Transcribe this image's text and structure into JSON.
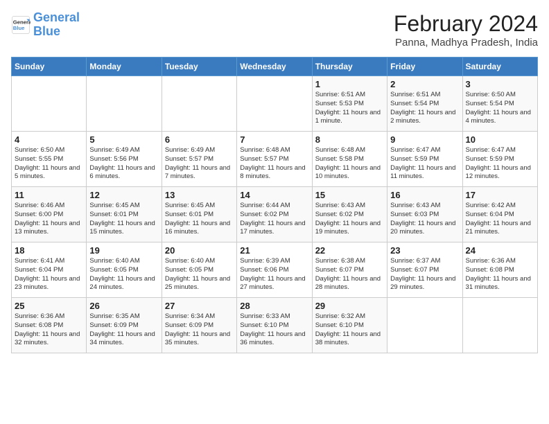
{
  "header": {
    "logo_line1": "General",
    "logo_line2": "Blue",
    "title": "February 2024",
    "subtitle": "Panna, Madhya Pradesh, India"
  },
  "columns": [
    "Sunday",
    "Monday",
    "Tuesday",
    "Wednesday",
    "Thursday",
    "Friday",
    "Saturday"
  ],
  "weeks": [
    [
      {
        "day": "",
        "info": ""
      },
      {
        "day": "",
        "info": ""
      },
      {
        "day": "",
        "info": ""
      },
      {
        "day": "",
        "info": ""
      },
      {
        "day": "1",
        "info": "Sunrise: 6:51 AM\nSunset: 5:53 PM\nDaylight: 11 hours and 1 minute."
      },
      {
        "day": "2",
        "info": "Sunrise: 6:51 AM\nSunset: 5:54 PM\nDaylight: 11 hours and 2 minutes."
      },
      {
        "day": "3",
        "info": "Sunrise: 6:50 AM\nSunset: 5:54 PM\nDaylight: 11 hours and 4 minutes."
      }
    ],
    [
      {
        "day": "4",
        "info": "Sunrise: 6:50 AM\nSunset: 5:55 PM\nDaylight: 11 hours and 5 minutes."
      },
      {
        "day": "5",
        "info": "Sunrise: 6:49 AM\nSunset: 5:56 PM\nDaylight: 11 hours and 6 minutes."
      },
      {
        "day": "6",
        "info": "Sunrise: 6:49 AM\nSunset: 5:57 PM\nDaylight: 11 hours and 7 minutes."
      },
      {
        "day": "7",
        "info": "Sunrise: 6:48 AM\nSunset: 5:57 PM\nDaylight: 11 hours and 8 minutes."
      },
      {
        "day": "8",
        "info": "Sunrise: 6:48 AM\nSunset: 5:58 PM\nDaylight: 11 hours and 10 minutes."
      },
      {
        "day": "9",
        "info": "Sunrise: 6:47 AM\nSunset: 5:59 PM\nDaylight: 11 hours and 11 minutes."
      },
      {
        "day": "10",
        "info": "Sunrise: 6:47 AM\nSunset: 5:59 PM\nDaylight: 11 hours and 12 minutes."
      }
    ],
    [
      {
        "day": "11",
        "info": "Sunrise: 6:46 AM\nSunset: 6:00 PM\nDaylight: 11 hours and 13 minutes."
      },
      {
        "day": "12",
        "info": "Sunrise: 6:45 AM\nSunset: 6:01 PM\nDaylight: 11 hours and 15 minutes."
      },
      {
        "day": "13",
        "info": "Sunrise: 6:45 AM\nSunset: 6:01 PM\nDaylight: 11 hours and 16 minutes."
      },
      {
        "day": "14",
        "info": "Sunrise: 6:44 AM\nSunset: 6:02 PM\nDaylight: 11 hours and 17 minutes."
      },
      {
        "day": "15",
        "info": "Sunrise: 6:43 AM\nSunset: 6:02 PM\nDaylight: 11 hours and 19 minutes."
      },
      {
        "day": "16",
        "info": "Sunrise: 6:43 AM\nSunset: 6:03 PM\nDaylight: 11 hours and 20 minutes."
      },
      {
        "day": "17",
        "info": "Sunrise: 6:42 AM\nSunset: 6:04 PM\nDaylight: 11 hours and 21 minutes."
      }
    ],
    [
      {
        "day": "18",
        "info": "Sunrise: 6:41 AM\nSunset: 6:04 PM\nDaylight: 11 hours and 23 minutes."
      },
      {
        "day": "19",
        "info": "Sunrise: 6:40 AM\nSunset: 6:05 PM\nDaylight: 11 hours and 24 minutes."
      },
      {
        "day": "20",
        "info": "Sunrise: 6:40 AM\nSunset: 6:05 PM\nDaylight: 11 hours and 25 minutes."
      },
      {
        "day": "21",
        "info": "Sunrise: 6:39 AM\nSunset: 6:06 PM\nDaylight: 11 hours and 27 minutes."
      },
      {
        "day": "22",
        "info": "Sunrise: 6:38 AM\nSunset: 6:07 PM\nDaylight: 11 hours and 28 minutes."
      },
      {
        "day": "23",
        "info": "Sunrise: 6:37 AM\nSunset: 6:07 PM\nDaylight: 11 hours and 29 minutes."
      },
      {
        "day": "24",
        "info": "Sunrise: 6:36 AM\nSunset: 6:08 PM\nDaylight: 11 hours and 31 minutes."
      }
    ],
    [
      {
        "day": "25",
        "info": "Sunrise: 6:36 AM\nSunset: 6:08 PM\nDaylight: 11 hours and 32 minutes."
      },
      {
        "day": "26",
        "info": "Sunrise: 6:35 AM\nSunset: 6:09 PM\nDaylight: 11 hours and 34 minutes."
      },
      {
        "day": "27",
        "info": "Sunrise: 6:34 AM\nSunset: 6:09 PM\nDaylight: 11 hours and 35 minutes."
      },
      {
        "day": "28",
        "info": "Sunrise: 6:33 AM\nSunset: 6:10 PM\nDaylight: 11 hours and 36 minutes."
      },
      {
        "day": "29",
        "info": "Sunrise: 6:32 AM\nSunset: 6:10 PM\nDaylight: 11 hours and 38 minutes."
      },
      {
        "day": "",
        "info": ""
      },
      {
        "day": "",
        "info": ""
      }
    ]
  ]
}
